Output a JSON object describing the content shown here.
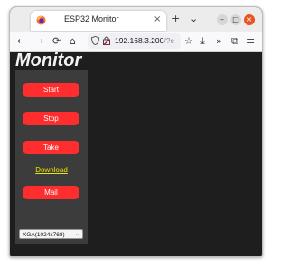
{
  "browser": {
    "tab_title": "ESP32 Monitor",
    "tab_close_glyph": "×",
    "new_tab_glyph": "+",
    "tab_list_glyph": "⌄",
    "window_controls": [
      "–",
      "□",
      "×"
    ],
    "nav": {
      "back": "←",
      "forward": "→",
      "reload": "⟳",
      "home": "⌂"
    },
    "url_host": "192.168.3.200",
    "url_rest": "/?c",
    "toolbar": {
      "bookmark": "☆",
      "downloads": "⤓",
      "overflow": "»",
      "extensions": "⧉",
      "menu": "≡"
    },
    "icons": [
      "firefox-logo-icon",
      "shield-icon",
      "lock-warning-icon"
    ]
  },
  "page": {
    "title": "Monitor",
    "buttons": {
      "start": "Start",
      "stop": "Stop",
      "take": "Take",
      "mail": "Mail"
    },
    "download_link": "Download",
    "resolution_select": {
      "value": "XGA(1024x768)",
      "arrow": "⌄"
    }
  },
  "colors": {
    "button_red": "#ff2d2d",
    "link_yellow": "#e6e600",
    "page_bg": "#1e1e1e",
    "panel_bg": "#3c3c3c",
    "close_orange": "#e95420"
  }
}
